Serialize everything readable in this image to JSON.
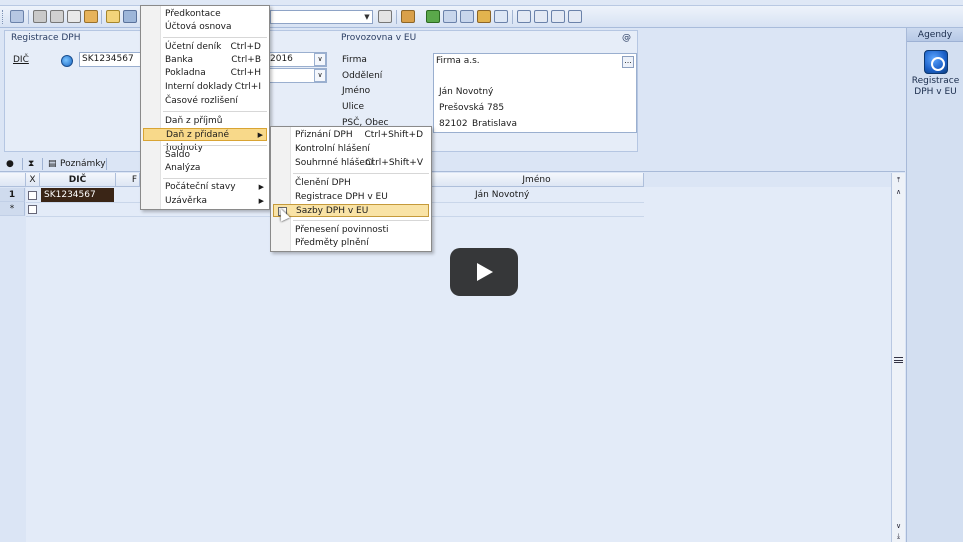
{
  "form": {
    "registration_title": "Registrace DPH",
    "dic_label": "DIČ",
    "dic_value": "SK1234567",
    "date_partial": "2016",
    "eu_title": "Provozovna v EU",
    "at_sign": "@",
    "eu_fields": [
      {
        "label": "Firma",
        "value": "Firma a.s."
      },
      {
        "label": "Oddělení",
        "value": ""
      },
      {
        "label": "Jméno",
        "value": "Ján Novotný"
      },
      {
        "label": "Ulice",
        "value": "Prešovská 785"
      },
      {
        "label": "PSČ, Obec",
        "value": "82102",
        "value2": "Bratislava"
      }
    ],
    "ellipsis": "..."
  },
  "grid": {
    "toolbar_notes": "Poznámky",
    "headers": {
      "x": "X",
      "dic": "DIČ",
      "f": "F",
      "jmeno": "Jméno"
    },
    "rows": [
      {
        "num": "1",
        "dic": "SK1234567",
        "jmeno": "Ján Novotný"
      },
      {
        "num": "*",
        "dic": "",
        "jmeno": ""
      }
    ]
  },
  "right_panel": {
    "title": "Agendy",
    "item_label_line1": "Registrace",
    "item_label_line2": "DPH v EU"
  },
  "menu": {
    "items": [
      {
        "label": "Předkontace",
        "shortcut": ""
      },
      {
        "label": "Účtová osnova",
        "shortcut": ""
      },
      {
        "label": "Účetní deník",
        "shortcut": "Ctrl+D"
      },
      {
        "label": "Banka",
        "shortcut": "Ctrl+B"
      },
      {
        "label": "Pokladna",
        "shortcut": "Ctrl+H"
      },
      {
        "label": "Interní doklady",
        "shortcut": "Ctrl+I"
      },
      {
        "label": "Časové rozlišení",
        "shortcut": ""
      },
      {
        "label": "Daň z příjmů",
        "shortcut": ""
      },
      {
        "label": "Daň z přidané hodnoty",
        "shortcut": ""
      },
      {
        "label": "Saldo",
        "shortcut": ""
      },
      {
        "label": "Analýza",
        "shortcut": ""
      },
      {
        "label": "Počáteční stavy",
        "shortcut": ""
      },
      {
        "label": "Uzávěrka",
        "shortcut": ""
      }
    ]
  },
  "submenu": {
    "items": [
      {
        "label": "Přiznání DPH",
        "shortcut": "Ctrl+Shift+D"
      },
      {
        "label": "Kontrolní hlášení",
        "shortcut": ""
      },
      {
        "label": "Souhrnné hlášení",
        "shortcut": "Ctrl+Shift+V"
      },
      {
        "label": "Členění DPH",
        "shortcut": ""
      },
      {
        "label": "Registrace DPH v EU",
        "shortcut": ""
      },
      {
        "label": "Sazby DPH v EU",
        "shortcut": ""
      },
      {
        "label": "Přenesení povinnosti",
        "shortcut": ""
      },
      {
        "label": "Předměty plnění",
        "shortcut": ""
      }
    ]
  },
  "colors": {
    "menu_highlight": "#f8d98a",
    "active_cell": "#3a2516",
    "panel_bg": "#dbe5f5"
  }
}
